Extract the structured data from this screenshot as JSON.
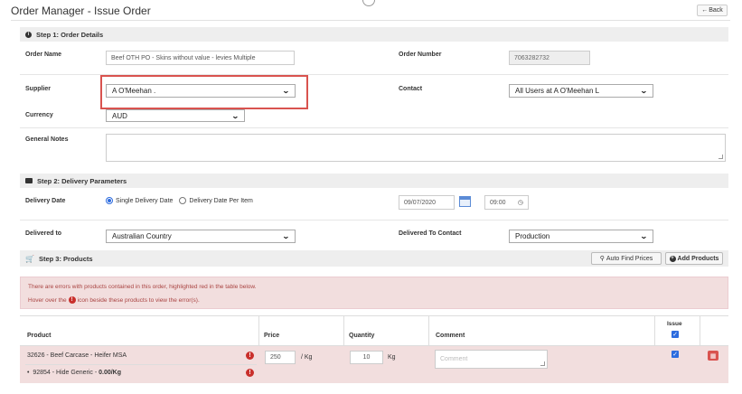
{
  "header": {
    "title": "Order Manager - Issue Order",
    "back_label": "Back",
    "back_icon": "arrow-left-icon"
  },
  "step1": {
    "title": "Step 1: Order Details",
    "order_name_label": "Order Name",
    "order_name_value": "Beef OTH PO - Skins without value - levies Multiple",
    "order_number_label": "Order Number",
    "order_number_value": "7063282732",
    "supplier_label": "Supplier",
    "supplier_value": "A O'Meehan .",
    "contact_label": "Contact",
    "contact_value": "All Users at A O'Meehan L",
    "currency_label": "Currency",
    "currency_value": "AUD",
    "notes_label": "General Notes",
    "notes_value": ""
  },
  "step2": {
    "title": "Step 2: Delivery Parameters",
    "delivery_date_label": "Delivery Date",
    "single_option": "Single Delivery Date",
    "per_item_option": "Delivery Date Per Item",
    "date_value": "09/07/2020",
    "time_value": "09:00",
    "delivered_to_label": "Delivered to",
    "delivered_to_value": "Australian Country",
    "delivered_contact_label": "Delivered To Contact",
    "delivered_contact_value": "Production"
  },
  "step3": {
    "title": "Step 3: Products",
    "auto_find_label": "Auto Find Prices",
    "add_products_label": "Add Products",
    "alert_line1": "There are errors with products contained in this order, highlighted red in the table below.",
    "alert_line2_a": "Hover over the",
    "alert_line2_b": "icon beside these products to view the error(s).",
    "columns": {
      "product": "Product",
      "price": "Price",
      "quantity": "Quantity",
      "comment": "Comment",
      "issue": "Issue"
    },
    "row": {
      "product": "32626 - Beef Carcase - Heifer MSA",
      "sub_product": "92854 - Hide Generic - ",
      "sub_price": "0.00/Kg",
      "price": "250",
      "price_unit": "/ Kg",
      "quantity": "10",
      "quantity_unit": "Kg",
      "comment_placeholder": "Comment"
    }
  },
  "colors": {
    "alert_bg": "#f2dede",
    "error_red": "#c9302c",
    "highlight_border": "#d9534f",
    "accent_blue": "#2d6cdf"
  }
}
